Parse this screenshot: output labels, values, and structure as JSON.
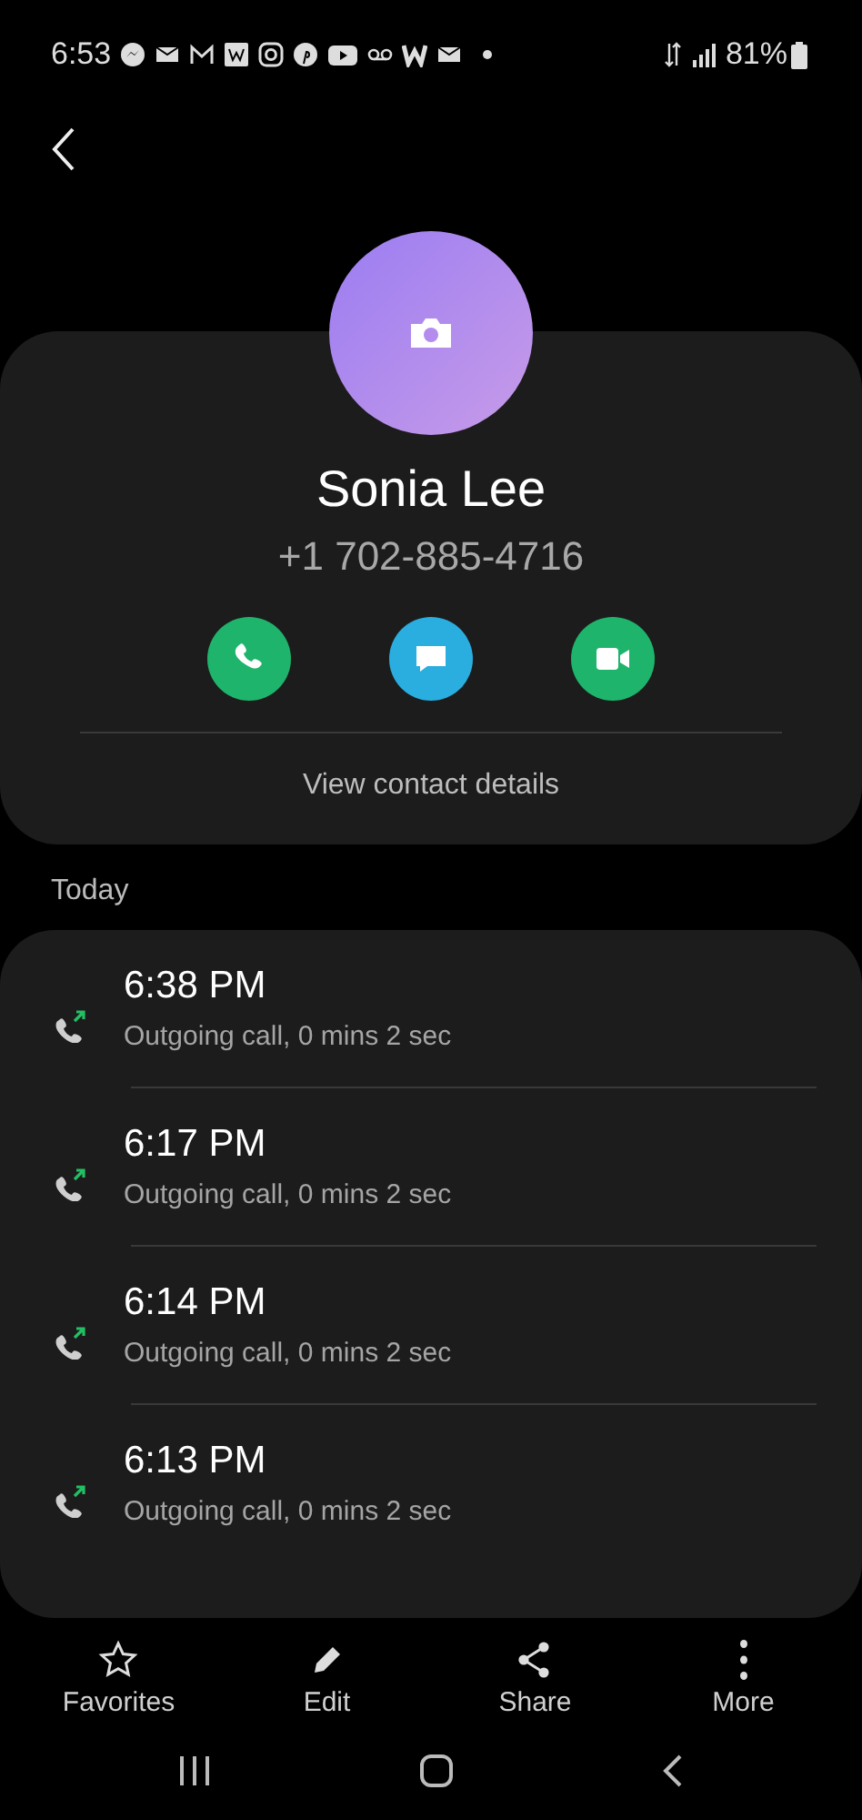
{
  "status_bar": {
    "time": "6:53",
    "battery": "81%"
  },
  "contact": {
    "name": "Sonia Lee",
    "phone": "+1 702-885-4716",
    "actions": [
      {
        "kind": "call"
      },
      {
        "kind": "message"
      },
      {
        "kind": "video"
      }
    ],
    "details_link": "View contact details"
  },
  "history": {
    "heading": "Today",
    "calls": [
      {
        "kind": "outgoing",
        "time": "6:38 PM",
        "detail": "Outgoing call, 0 mins 2 sec"
      },
      {
        "kind": "outgoing",
        "time": "6:17 PM",
        "detail": "Outgoing call, 0 mins 2 sec"
      },
      {
        "kind": "outgoing",
        "time": "6:14 PM",
        "detail": "Outgoing call, 0 mins 2 sec"
      },
      {
        "kind": "outgoing",
        "time": "6:13 PM",
        "detail": "Outgoing call, 0 mins 2 sec"
      }
    ]
  },
  "bottom_bar": [
    {
      "kind": "favorite",
      "label": "Favorites"
    },
    {
      "kind": "edit",
      "label": "Edit"
    },
    {
      "kind": "share",
      "label": "Share"
    },
    {
      "kind": "more",
      "label": "More"
    }
  ]
}
